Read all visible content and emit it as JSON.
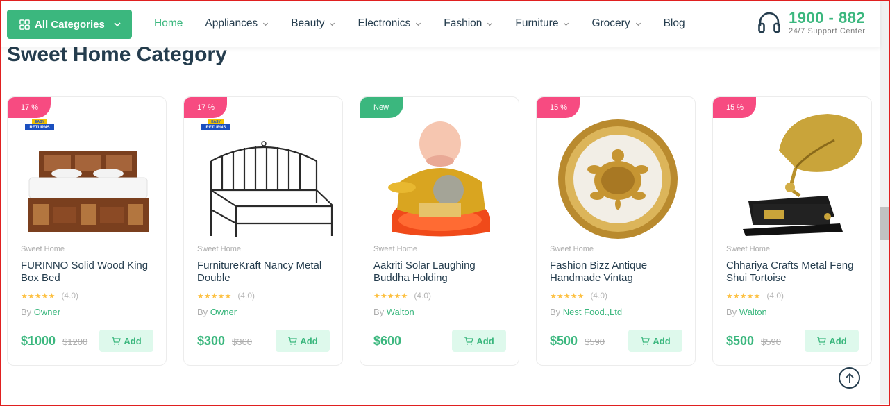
{
  "header": {
    "categories_button": "All Categories",
    "nav": [
      {
        "label": "Home",
        "active": true,
        "dropdown": false
      },
      {
        "label": "Appliances",
        "dropdown": true
      },
      {
        "label": "Beauty",
        "dropdown": true
      },
      {
        "label": "Electronics",
        "dropdown": true
      },
      {
        "label": "Fashion",
        "dropdown": true
      },
      {
        "label": "Furniture",
        "dropdown": true
      },
      {
        "label": "Grocery",
        "dropdown": true
      },
      {
        "label": "Blog",
        "dropdown": false
      }
    ],
    "support_phone": "1900 - 882",
    "support_label": "24/7 Support Center"
  },
  "section": {
    "title": "Sweet Home Category"
  },
  "products": [
    {
      "badge": "17 %",
      "badge_type": "sale",
      "easy_returns": true,
      "category": "Sweet Home",
      "name": "FURINNO Solid Wood King Box Bed",
      "stars": "★★★★★",
      "rating": "(4.0)",
      "by_prefix": "By",
      "vendor": "Owner",
      "price": "$1000",
      "old_price": "$1200",
      "add_label": "Add",
      "image": "wooden-bed"
    },
    {
      "badge": "17 %",
      "badge_type": "sale",
      "easy_returns": true,
      "category": "Sweet Home",
      "name": "FurnitureKraft Nancy Metal Double",
      "stars": "★★★★★",
      "rating": "(4.0)",
      "by_prefix": "By",
      "vendor": "Owner",
      "price": "$300",
      "old_price": "$360",
      "add_label": "Add",
      "image": "metal-bed"
    },
    {
      "badge": "New",
      "badge_type": "new",
      "easy_returns": false,
      "category": "Sweet Home",
      "name": "Aakriti Solar Laughing Buddha Holding",
      "stars": "★★★★★",
      "rating": "(4.0)",
      "by_prefix": "By",
      "vendor": "Walton",
      "price": "$600",
      "old_price": "",
      "add_label": "Add",
      "image": "laughing-buddha"
    },
    {
      "badge": "15 %",
      "badge_type": "sale",
      "easy_returns": false,
      "category": "Sweet Home",
      "name": "Fashion Bizz Antique Handmade Vintag",
      "stars": "★★★★★",
      "rating": "(4.0)",
      "by_prefix": "By",
      "vendor": "Nest Food.,Ltd",
      "price": "$500",
      "old_price": "$590",
      "add_label": "Add",
      "image": "tortoise-plate"
    },
    {
      "badge": "15 %",
      "badge_type": "sale",
      "easy_returns": false,
      "category": "Sweet Home",
      "name": "Chhariya Crafts Metal Feng Shui Tortoise",
      "stars": "★★★★★",
      "rating": "(4.0)",
      "by_prefix": "By",
      "vendor": "Walton",
      "price": "$500",
      "old_price": "$590",
      "add_label": "Add",
      "image": "gramophone"
    }
  ],
  "easy_returns_text": [
    "EASY",
    "RETURNS"
  ],
  "colors": {
    "brand": "#3bb77e",
    "sale": "#f74b81",
    "text": "#253d4e",
    "star": "#fdc040"
  }
}
